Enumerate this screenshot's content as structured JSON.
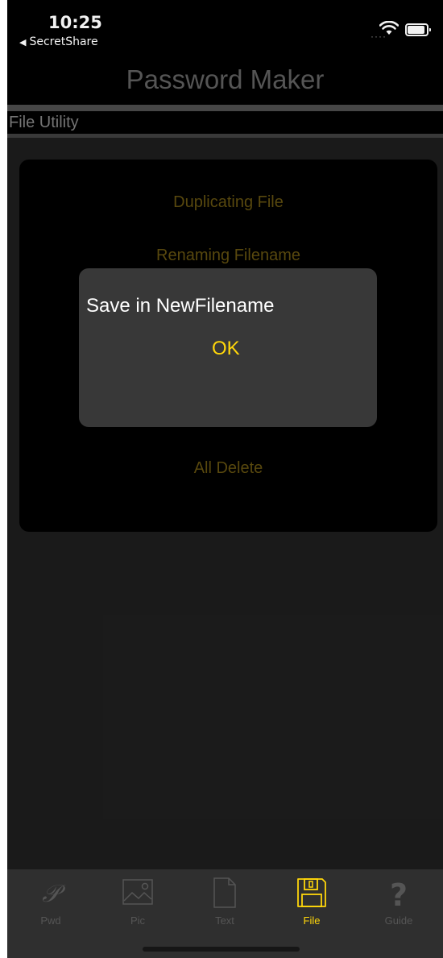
{
  "status_bar": {
    "time": "10:25",
    "back_app": "SecretShare",
    "back_arrow": "◀"
  },
  "nav": {
    "title": "Password Maker"
  },
  "section": {
    "title": "File Utility"
  },
  "menu": {
    "items": [
      "Duplicating File",
      "Renaming Filename",
      "All Delete"
    ]
  },
  "alert": {
    "message": "Save in NewFilename",
    "ok_label": "OK"
  },
  "tabs": [
    {
      "label": "Pwd",
      "icon": "script-p-icon",
      "active": false
    },
    {
      "label": "Pic",
      "icon": "picture-icon",
      "active": false
    },
    {
      "label": "Text",
      "icon": "document-icon",
      "active": false
    },
    {
      "label": "File",
      "icon": "floppy-disk-icon",
      "active": true
    },
    {
      "label": "Guide",
      "icon": "question-mark-icon",
      "active": false
    }
  ],
  "colors": {
    "accent": "#ffd60a",
    "dim_text": "#5d4c0f",
    "background": "#1c1c1c"
  }
}
